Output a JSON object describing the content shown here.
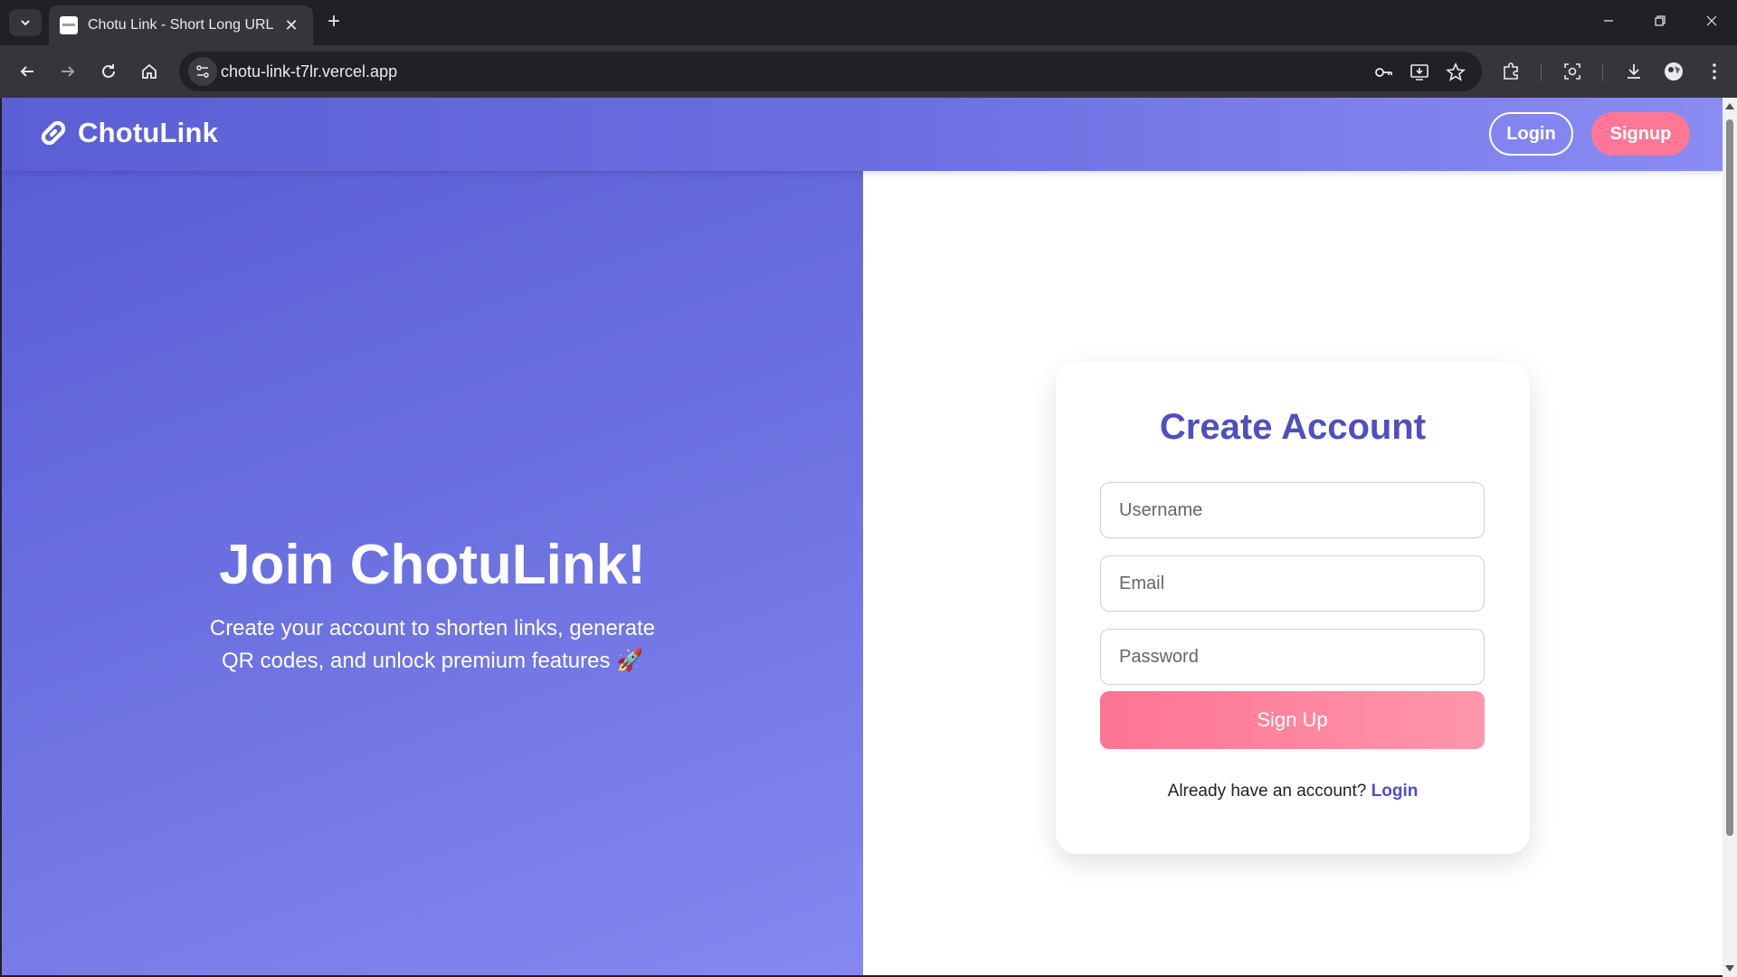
{
  "browser": {
    "tab_title": "Chotu Link - Short Long URL",
    "url": "chotu-link-t7lr.vercel.app"
  },
  "header": {
    "brand": "ChotuLink",
    "login_label": "Login",
    "signup_label": "Signup"
  },
  "hero": {
    "title": "Join ChotuLink!",
    "subtitle": "Create your account to shorten links, generate QR codes, and unlock premium features 🚀"
  },
  "form": {
    "title": "Create Account",
    "username_placeholder": "Username",
    "email_placeholder": "Email",
    "password_placeholder": "Password",
    "submit_label": "Sign Up",
    "switch_prompt": "Already have an account?",
    "switch_link": "Login"
  },
  "colors": {
    "header_gradient_start": "#5b5fd6",
    "header_gradient_end": "#8a8cf4",
    "accent_pink": "#fe7796",
    "title_indigo": "#4f4fbd"
  }
}
